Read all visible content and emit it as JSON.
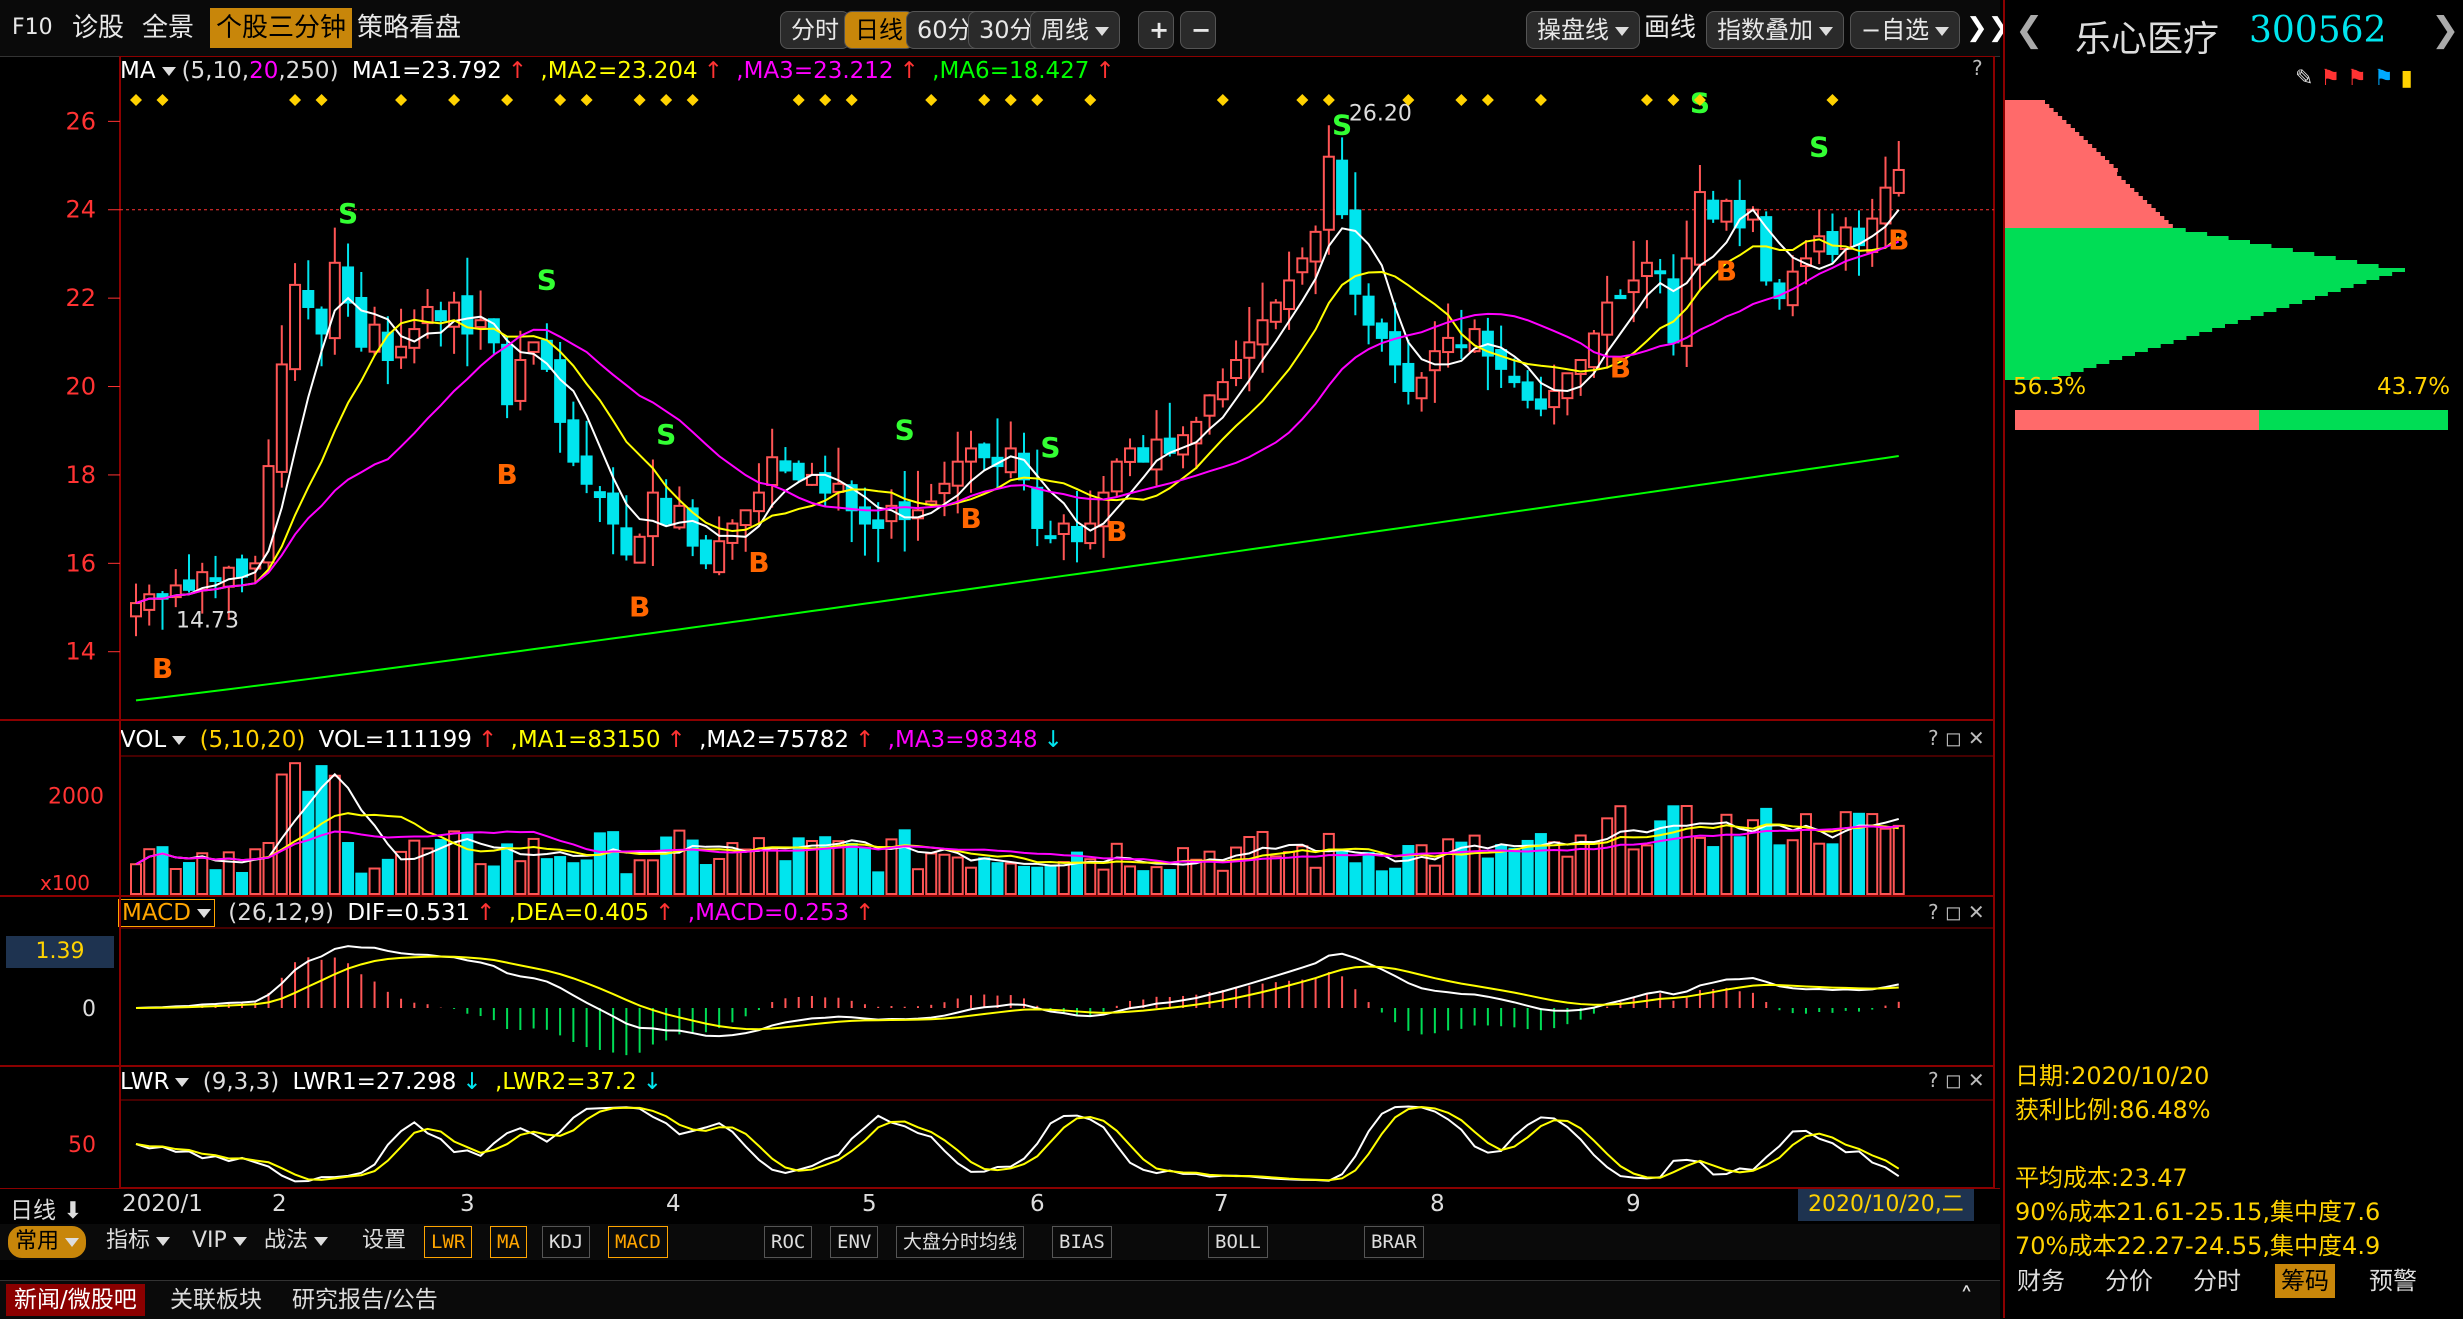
{
  "toolbar": {
    "f10": "F10",
    "diagnose": "诊股",
    "panorama": "全景",
    "three_min": "个股三分钟",
    "strategy": "策略看盘",
    "timeshare": "分时",
    "daily": "日线",
    "m60": "60分",
    "m30": "30分",
    "weekly": "周线",
    "plus": "+",
    "minus": "−",
    "trade_line": "操盘线",
    "draw_line": "画线",
    "index_overlay": "指数叠加",
    "self_select": "−自选",
    "close": "✕"
  },
  "main_header": {
    "indicator": "MA",
    "params_prefix": "(5,10,",
    "params_p3": "20",
    "params_p4": ",250)",
    "ma1": "MA1=23.792",
    "ma2": ",MA2=23.204",
    "ma3": ",MA3=23.212",
    "ma6": ",MA6=18.427",
    "help": "?"
  },
  "vol_header": {
    "indicator": "VOL",
    "params": "(5,10,20)",
    "vol": "VOL=111199",
    "ma1": ",MA1=83150",
    "ma2": ",MA2=75782",
    "ma3": ",MA3=98348",
    "help": "? ◻ ✕"
  },
  "macd_header": {
    "indicator": "MACD",
    "params": "(26,12,9)",
    "dif": "DIF=0.531",
    "dea": ",DEA=0.405",
    "macd": ",MACD=0.253",
    "help": "? ◻ ✕"
  },
  "lwr_header": {
    "indicator": "LWR",
    "params": "(9,3,3)",
    "lwr1": "LWR1=27.298",
    "lwr2": ",LWR2=37.2",
    "help": "? ◻ ✕"
  },
  "macd_left_value": "1.39",
  "date_axis": {
    "label": "日线",
    "dates": [
      "2020/1",
      "2",
      "3",
      "4",
      "5",
      "6",
      "7",
      "8",
      "9"
    ],
    "current": "2020/10/20,二"
  },
  "stock": {
    "name": "乐心医疗",
    "code": "300562"
  },
  "chip": {
    "left_pct": "56.3%",
    "right_pct": "43.7%",
    "profit_split": 0.563
  },
  "chip_info": {
    "date": "日期:2020/10/20",
    "profit_ratio": "获利比例:86.48%",
    "avg_cost": "平均成本:23.47",
    "cost90": "90%成本21.61-25.15,集中度7.6",
    "cost70": "70%成本22.27-24.55,集中度4.9"
  },
  "right_tabs": [
    "财务",
    "分价",
    "分时",
    "筹码",
    "预警"
  ],
  "right_tab_active": 3,
  "bottom_tabs": [
    "常用",
    "指标",
    "VIP",
    "战法",
    "设置"
  ],
  "indicator_tabs": [
    "LWR",
    "MA",
    "KDJ",
    "MACD",
    "ROC",
    "ENV",
    "大盘分时均线",
    "BIAS",
    "BOLL",
    "BRAR"
  ],
  "indicator_active": [
    0,
    1,
    3
  ],
  "news_tabs": [
    "新闻/微股吧",
    "关联板块",
    "研究报告/公告"
  ],
  "colors": {
    "up": "#ff5555",
    "down": "#00e5ee",
    "ma1": "#ffffff",
    "ma2": "#ffff00",
    "ma3": "#ff00ff",
    "ma6": "#00ff00",
    "frame": "#8b0000",
    "signal_b": "#ff6600",
    "signal_s": "#33ff33"
  },
  "chart_data": {
    "type": "candlestick",
    "price_axis": {
      "ticks": [
        14,
        16,
        18,
        20,
        22,
        24,
        26
      ],
      "range": [
        12.5,
        26.8
      ]
    },
    "annotations": {
      "high": "26.20",
      "low": "14.73"
    },
    "ma_values": {
      "ma1": 23.792,
      "ma2": 23.204,
      "ma3": 23.212,
      "ma6": 18.427
    },
    "candles": [
      15.1,
      15.3,
      15.2,
      15.5,
      15.4,
      15.8,
      15.6,
      15.9,
      15.7,
      16.0,
      18.2,
      20.5,
      22.3,
      21.8,
      21.2,
      22.8,
      21.9,
      20.9,
      21.4,
      20.6,
      20.9,
      21.3,
      21.8,
      21.5,
      21.9,
      21.2,
      21.5,
      21.0,
      19.6,
      20.6,
      21.0,
      20.4,
      19.2,
      18.3,
      17.8,
      17.5,
      16.9,
      16.2,
      16.6,
      17.6,
      16.9,
      17.3,
      16.4,
      16.0,
      16.5,
      16.9,
      17.2,
      17.6,
      18.4,
      18.1,
      17.9,
      18.0,
      17.6,
      17.8,
      17.2,
      16.9,
      16.8,
      17.3,
      17.0,
      17.2,
      17.4,
      17.8,
      18.3,
      18.6,
      18.4,
      18.2,
      18.6,
      17.9,
      16.8,
      16.6,
      16.9,
      16.5,
      16.9,
      17.6,
      18.3,
      18.6,
      18.3,
      18.8,
      18.5,
      18.9,
      19.2,
      19.8,
      20.1,
      20.6,
      21.0,
      21.5,
      21.9,
      22.4,
      22.9,
      23.5,
      25.2,
      23.9,
      22.1,
      21.4,
      21.1,
      20.5,
      19.9,
      20.2,
      20.8,
      21.1,
      20.9,
      21.3,
      20.7,
      20.4,
      20.1,
      19.7,
      19.5,
      19.9,
      20.3,
      20.6,
      21.2,
      21.9,
      22.0,
      22.4,
      22.8,
      22.6,
      21.0,
      22.9,
      24.4,
      23.8,
      24.2,
      23.6,
      24.0,
      22.4,
      22.0,
      22.6,
      22.9,
      23.4,
      23.0,
      23.6,
      23.2,
      23.8,
      24.5,
      24.9
    ],
    "volume_axis": {
      "ticks": [
        2000
      ],
      "unit": "x100"
    },
    "macd_axis": {
      "ticks": [
        0
      ]
    },
    "lwr_axis": {
      "ticks": [
        50
      ]
    },
    "signals": [
      {
        "type": "B",
        "i": 2
      },
      {
        "type": "S",
        "i": 16
      },
      {
        "type": "B",
        "i": 28
      },
      {
        "type": "S",
        "i": 31
      },
      {
        "type": "S",
        "i": 40
      },
      {
        "type": "B",
        "i": 38
      },
      {
        "type": "B",
        "i": 47
      },
      {
        "type": "S",
        "i": 58
      },
      {
        "type": "B",
        "i": 63
      },
      {
        "type": "S",
        "i": 69
      },
      {
        "type": "B",
        "i": 74
      },
      {
        "type": "S",
        "i": 91
      },
      {
        "type": "B",
        "i": 112
      },
      {
        "type": "S",
        "i": 118
      },
      {
        "type": "B",
        "i": 120
      },
      {
        "type": "S",
        "i": 127
      },
      {
        "type": "B",
        "i": 133
      }
    ]
  }
}
